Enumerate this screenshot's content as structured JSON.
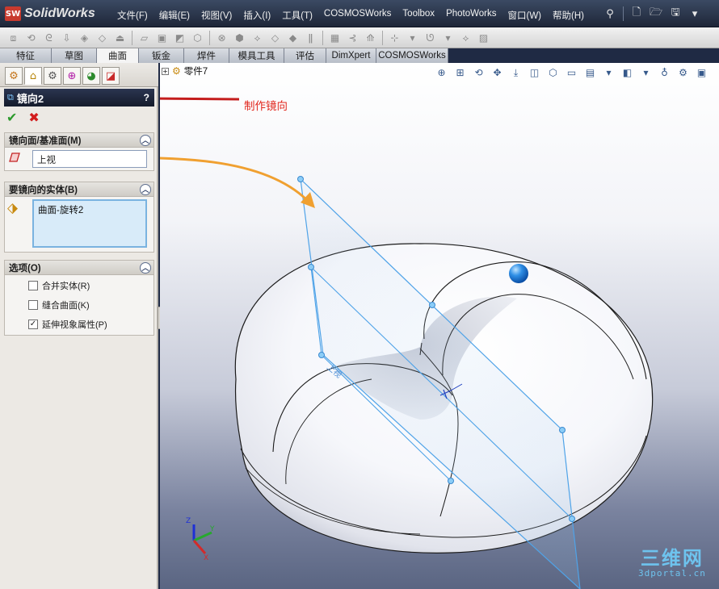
{
  "app": {
    "logo_badge": "SW",
    "name": "SolidWorks"
  },
  "menu": [
    "文件(F)",
    "编辑(E)",
    "视图(V)",
    "插入(I)",
    "工具(T)",
    "COSMOSWorks",
    "Toolbox",
    "PhotoWorks",
    "窗口(W)",
    "帮助(H)"
  ],
  "tabs": [
    {
      "label": "特征",
      "active": false
    },
    {
      "label": "草图",
      "active": false
    },
    {
      "label": "曲面",
      "active": true
    },
    {
      "label": "钣金",
      "active": false
    },
    {
      "label": "焊件",
      "active": false
    },
    {
      "label": "模具工具",
      "active": false
    },
    {
      "label": "评估",
      "active": false
    },
    {
      "label": "DimXpert",
      "active": false
    },
    {
      "label": "COSMOSWorks",
      "active": false
    }
  ],
  "property_manager": {
    "title": "镜向2",
    "help": "?",
    "groups": {
      "mirror_plane": {
        "title": "镜向面/基准面(M)",
        "value": "上视"
      },
      "bodies": {
        "title": "要镜向的实体(B)",
        "items": [
          "曲面-旋转2"
        ]
      },
      "options": {
        "title": "选项(O)",
        "checkboxes": [
          {
            "label": "合并实体(R)",
            "checked": false
          },
          {
            "label": "缝合曲面(K)",
            "checked": false
          },
          {
            "label": "延伸视象属性(P)",
            "checked": true
          }
        ]
      }
    }
  },
  "viewport": {
    "tree_root": "零件7",
    "triad": {
      "x": "X",
      "y": "Y",
      "z": "Z"
    },
    "plane_label": "上视"
  },
  "annotation": {
    "label": "制作镜向",
    "arrow_color": "#c41d1d",
    "callout_color": "#f0a030"
  },
  "watermark": {
    "main": "三维网",
    "sub": "3dportal.cn"
  },
  "colors": {
    "plane": "#4fa3e8",
    "model_edge": "#1b1b1b",
    "accent": "#2a3550"
  }
}
